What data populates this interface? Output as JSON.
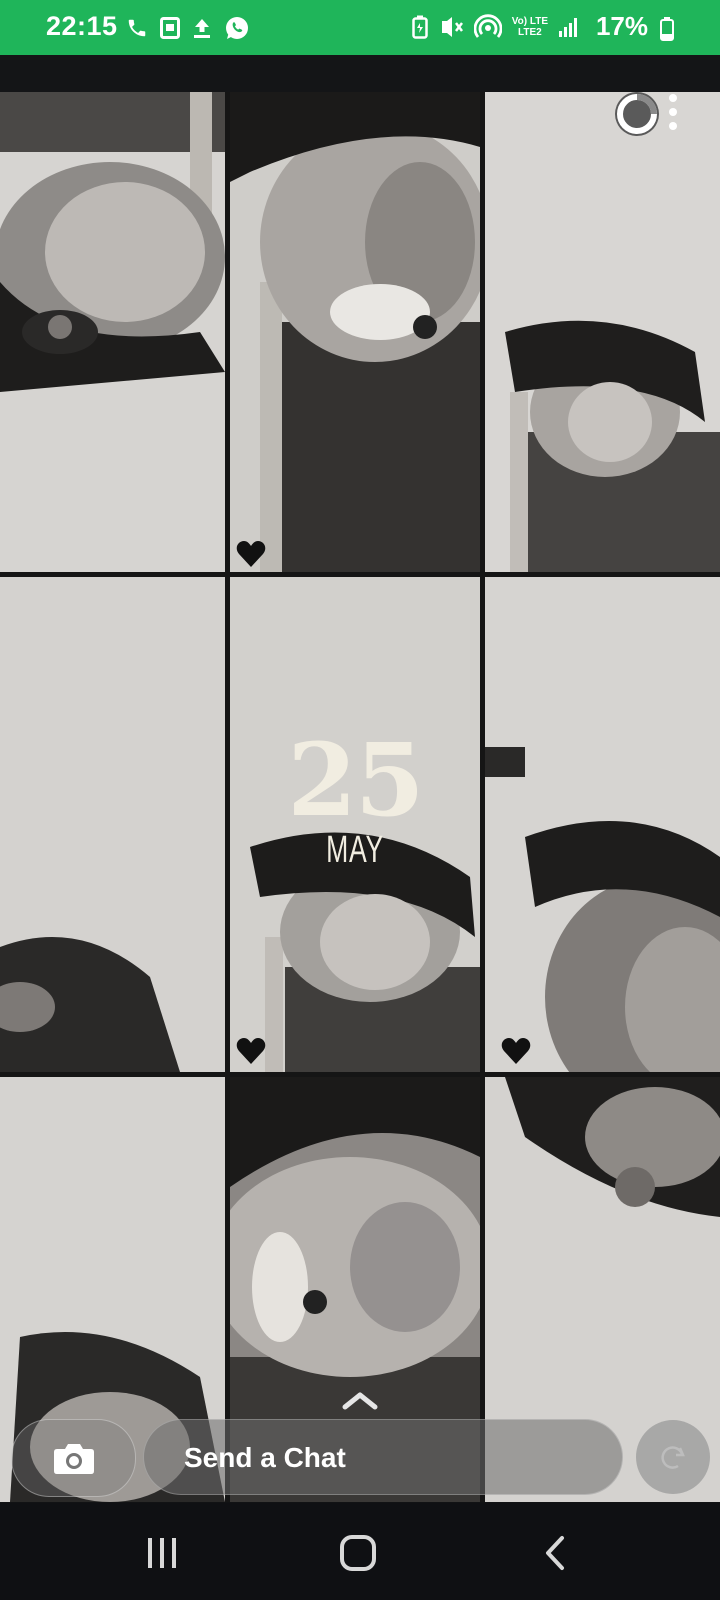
{
  "status_bar": {
    "time": "22:15",
    "left_icons": [
      "phone-icon",
      "screenshot-icon",
      "upload-icon",
      "whatsapp-icon"
    ],
    "right_icons": [
      "battery-saver-icon",
      "vibrate-icon",
      "hotspot-icon",
      "volte-lte-icon",
      "signal-icon"
    ],
    "net_top": "Vo) LTE",
    "net_bottom": "LTE2",
    "battery_percent": "17%",
    "color": "#1fb55a"
  },
  "story": {
    "date_day": "25",
    "date_month": "MAY",
    "favorited_cells": [
      2,
      4,
      5
    ],
    "grid_rows": 3,
    "grid_cols": 3
  },
  "controls": {
    "story_ring_icon": "story-progress-ring-icon",
    "menu_icon": "more-vertical-icon",
    "swipe_icon": "chevron-up-icon"
  },
  "chat_bar": {
    "camera_icon": "camera-icon",
    "placeholder": "Send a Chat",
    "share_icon": "share-icon"
  },
  "nav_bar": {
    "items": [
      "recent-apps-icon",
      "home-icon",
      "back-icon"
    ]
  }
}
